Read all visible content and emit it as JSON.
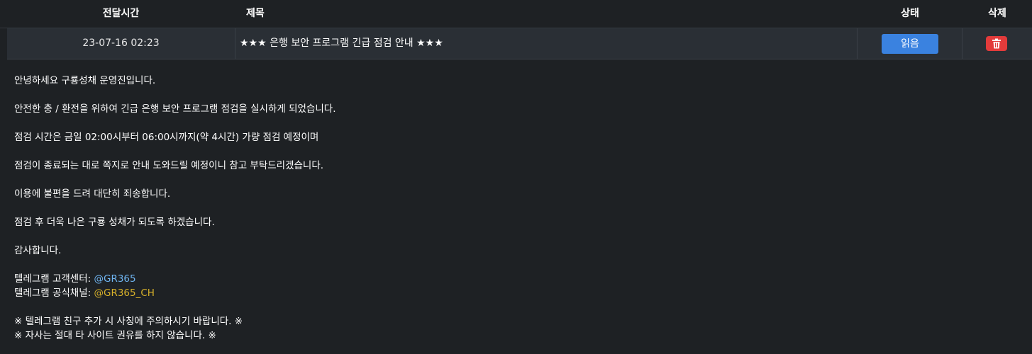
{
  "table": {
    "headers": {
      "time": "전달시간",
      "title": "제목",
      "status": "상태",
      "delete": "삭제"
    },
    "row": {
      "time": "23-07-16 02:23",
      "title": "★★★ 은행 보안 프로그램 긴급 점검 안내 ★★★",
      "status_button": "읽음",
      "delete_icon": "trash-icon"
    }
  },
  "message": {
    "line1": "안녕하세요 구룡성채 운영진입니다.",
    "line2": "안전한 충 / 환전을 위하여 긴급 은행 보안 프로그램 점검을 실시하게 되었습니다.",
    "line3": "점검 시간은 금일 02:00시부터 06:00시까지(약 4시간) 가량 점검 예정이며",
    "line4": "점검이 종료되는 대로 쪽지로 안내 도와드릴 예정이니 참고 부탁드리겠습니다.",
    "line5": "이용에 불편을 드려 대단히 죄송합니다.",
    "line6": "점검 후 더욱 나은 구룡 성채가 되도록 하겠습니다.",
    "line7": "감사합니다.",
    "support_label": "텔레그램 고객센터: ",
    "support_handle": "@GR365",
    "channel_label": "텔레그램 공식채널: ",
    "channel_handle": "@GR365_CH",
    "notice1": "※ 텔레그램 친구 추가 시 사칭에 주의하시기 바랍니다. ※",
    "notice2": "※ 자사는 절대 타 사이트 권유를 하지 않습니다. ※"
  },
  "colors": {
    "background": "#1e2124",
    "row_background": "#2a2f35",
    "read_button": "#3a82e0",
    "delete_button": "#e33b3b",
    "link_blue": "#6fb4f0",
    "link_yellow": "#d6b02a"
  }
}
